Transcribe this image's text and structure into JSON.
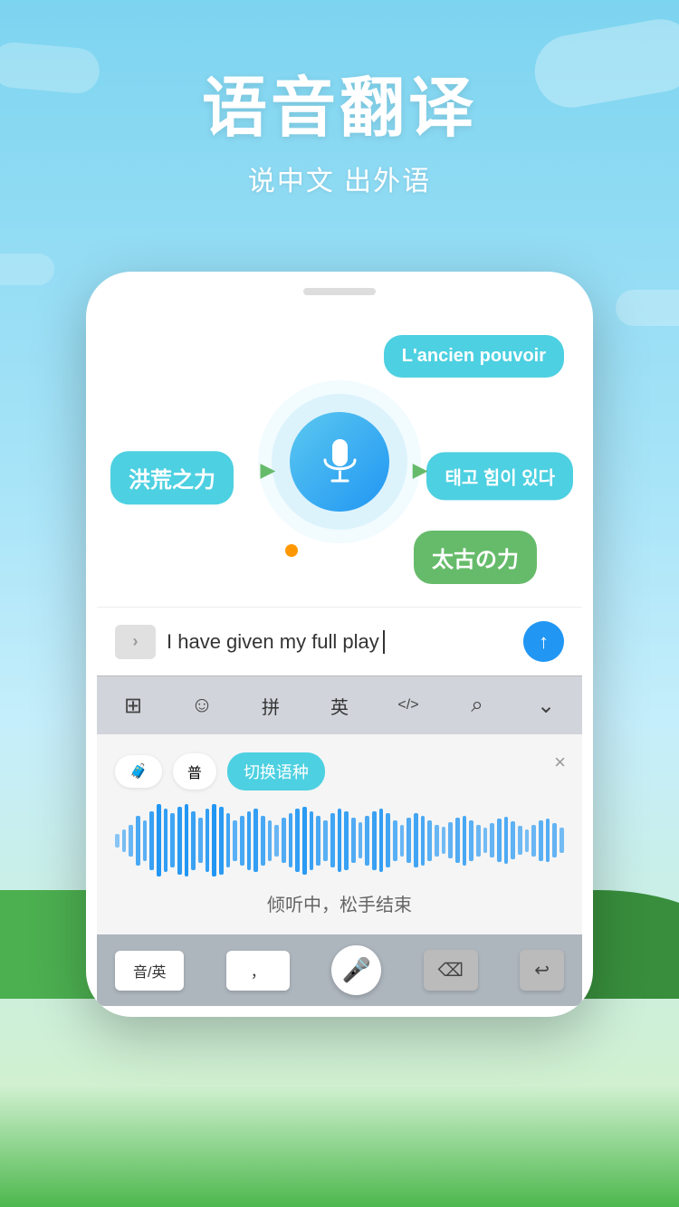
{
  "header": {
    "main_title": "语音翻译",
    "sub_title": "说中文 出外语"
  },
  "chat": {
    "bubble_chinese": "洪荒之力",
    "bubble_french": "L'ancien pouvoir",
    "bubble_korean": "태고 힘이 있다",
    "bubble_japanese": "太古の力"
  },
  "input": {
    "text": "I have given my full play",
    "chevron": "›",
    "send_icon": "↑"
  },
  "keyboard_toolbar": {
    "grid_icon": "⊞",
    "emoji_icon": "☺",
    "pinyin": "拼",
    "english": "英",
    "code_icon": "〈/〉",
    "search_icon": "⌕",
    "more_icon": "⌄"
  },
  "voice": {
    "badge1_icon": "briefcase",
    "badge2": "普",
    "switch_label": "切换语种",
    "close_icon": "×",
    "listening_text": "倾听中，松手结束"
  },
  "keyboard_bottom": {
    "left_key": "音/英",
    "punctuation": "，",
    "mic_icon": "🎤",
    "delete_icon": "⌫",
    "return_icon": "↩"
  },
  "colors": {
    "sky_top": "#7dd4f0",
    "bubble_teal": "#4dd0e1",
    "bubble_green": "#66bb6a",
    "mic_blue": "#2196f3",
    "waveform_blue": "#1976d2"
  },
  "waveform": {
    "bars": [
      15,
      25,
      35,
      55,
      45,
      65,
      80,
      70,
      60,
      75,
      80,
      65,
      50,
      70,
      80,
      75,
      60,
      45,
      55,
      65,
      70,
      55,
      45,
      35,
      50,
      60,
      70,
      75,
      65,
      55,
      45,
      60,
      70,
      65,
      50,
      40,
      55,
      65,
      70,
      60,
      45,
      35,
      50,
      60,
      55,
      45,
      35,
      30,
      40,
      50,
      55,
      45,
      35,
      28,
      38,
      48,
      52,
      42,
      32,
      25,
      35,
      45,
      48,
      38,
      28
    ]
  }
}
